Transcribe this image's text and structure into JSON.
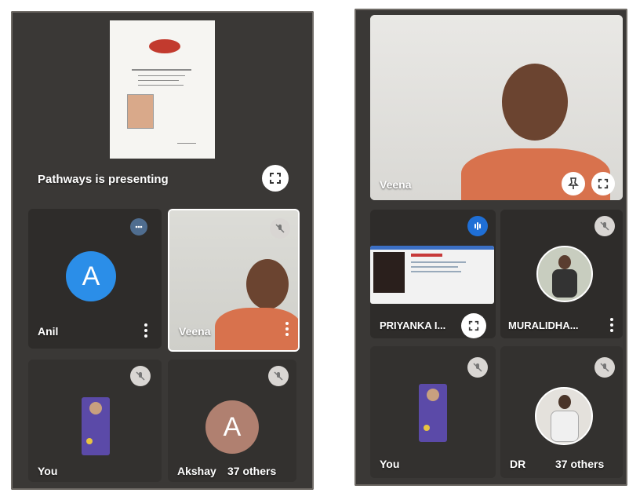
{
  "left_screen": {
    "presenting_label": "Pathways is presenting",
    "tiles": [
      {
        "name": "Anil",
        "avatar_letter": "A",
        "avatar_color": "#2b8ee8"
      },
      {
        "name": "Veena"
      },
      {
        "name": "You"
      },
      {
        "name": "Akshay",
        "avatar_letter": "A",
        "avatar_color": "#b08070",
        "others": "37 others"
      }
    ]
  },
  "right_screen": {
    "featured_name": "Veena",
    "tiles": [
      {
        "name": "PRIYANKA I..."
      },
      {
        "name": "MURALIDHA..."
      },
      {
        "name": "You"
      },
      {
        "name": "DR",
        "others": "37 others"
      }
    ]
  },
  "colors": {
    "screen_bg": "#3a3836",
    "tile_bg": "#2e2c2a",
    "accent_blue": "#1f6fd6"
  }
}
